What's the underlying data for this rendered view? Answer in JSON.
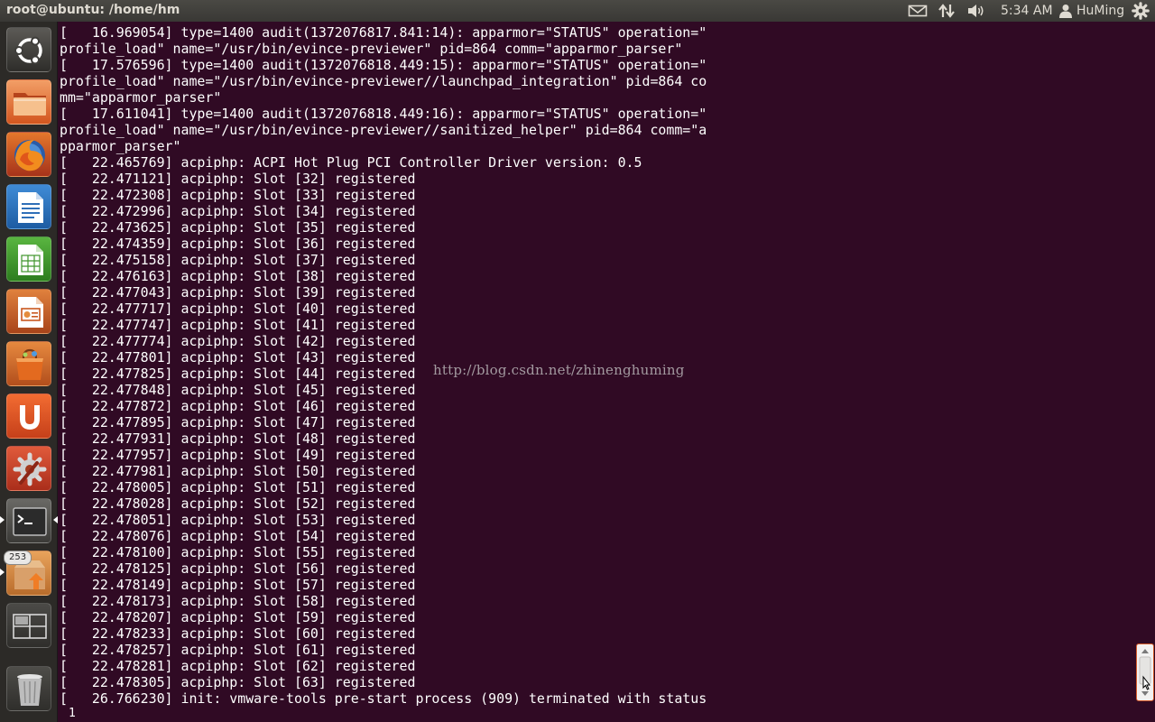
{
  "window": {
    "title": "root@ubuntu: /home/hm"
  },
  "panel": {
    "indicators": [
      "mail-icon",
      "network-icon",
      "volume-icon"
    ],
    "clock": "5:34 AM",
    "user": "HuMing"
  },
  "launcher": {
    "items": [
      {
        "name": "dash-home",
        "icon": "ubuntu-logo-icon"
      },
      {
        "name": "files",
        "icon": "folder-icon"
      },
      {
        "name": "firefox",
        "icon": "firefox-icon"
      },
      {
        "name": "writer",
        "icon": "libreoffice-writer-icon"
      },
      {
        "name": "calc",
        "icon": "libreoffice-calc-icon"
      },
      {
        "name": "impress",
        "icon": "libreoffice-impress-icon"
      },
      {
        "name": "software-center",
        "icon": "shopping-bag-icon"
      },
      {
        "name": "ubuntu-one",
        "icon": "ubuntu-one-icon"
      },
      {
        "name": "system-settings",
        "icon": "gear-wrench-icon"
      },
      {
        "name": "terminal",
        "icon": "terminal-icon"
      },
      {
        "name": "update-manager",
        "icon": "update-box-icon",
        "badge": "253"
      },
      {
        "name": "workspaces",
        "icon": "workspace-switcher-icon"
      },
      {
        "name": "trash",
        "icon": "trash-icon"
      }
    ],
    "colors": {
      "active_indicator": "#ffffff",
      "background": "#2c2a27"
    }
  },
  "terminal": {
    "colors": {
      "background": "#300a24",
      "foreground": "#ffffff"
    },
    "lines": [
      "[   16.969054] type=1400 audit(1372076817.841:14): apparmor=\"STATUS\" operation=\"",
      "profile_load\" name=\"/usr/bin/evince-previewer\" pid=864 comm=\"apparmor_parser\"",
      "[   17.576596] type=1400 audit(1372076818.449:15): apparmor=\"STATUS\" operation=\"",
      "profile_load\" name=\"/usr/bin/evince-previewer//launchpad_integration\" pid=864 co",
      "mm=\"apparmor_parser\"",
      "[   17.611041] type=1400 audit(1372076818.449:16): apparmor=\"STATUS\" operation=\"",
      "profile_load\" name=\"/usr/bin/evince-previewer//sanitized_helper\" pid=864 comm=\"a",
      "pparmor_parser\"",
      "[   22.465769] acpiphp: ACPI Hot Plug PCI Controller Driver version: 0.5",
      "[   22.471121] acpiphp: Slot [32] registered",
      "[   22.472308] acpiphp: Slot [33] registered",
      "[   22.472996] acpiphp: Slot [34] registered",
      "[   22.473625] acpiphp: Slot [35] registered",
      "[   22.474359] acpiphp: Slot [36] registered",
      "[   22.475158] acpiphp: Slot [37] registered",
      "[   22.476163] acpiphp: Slot [38] registered",
      "[   22.477043] acpiphp: Slot [39] registered",
      "[   22.477717] acpiphp: Slot [40] registered",
      "[   22.477747] acpiphp: Slot [41] registered",
      "[   22.477774] acpiphp: Slot [42] registered",
      "[   22.477801] acpiphp: Slot [43] registered",
      "[   22.477825] acpiphp: Slot [44] registered",
      "[   22.477848] acpiphp: Slot [45] registered",
      "[   22.477872] acpiphp: Slot [46] registered",
      "[   22.477895] acpiphp: Slot [47] registered",
      "[   22.477931] acpiphp: Slot [48] registered",
      "[   22.477957] acpiphp: Slot [49] registered",
      "[   22.477981] acpiphp: Slot [50] registered",
      "[   22.478005] acpiphp: Slot [51] registered",
      "[   22.478028] acpiphp: Slot [52] registered",
      "[   22.478051] acpiphp: Slot [53] registered",
      "[   22.478076] acpiphp: Slot [54] registered",
      "[   22.478100] acpiphp: Slot [55] registered",
      "[   22.478125] acpiphp: Slot [56] registered",
      "[   22.478149] acpiphp: Slot [57] registered",
      "[   22.478173] acpiphp: Slot [58] registered",
      "[   22.478207] acpiphp: Slot [59] registered",
      "[   22.478233] acpiphp: Slot [60] registered",
      "[   22.478257] acpiphp: Slot [61] registered",
      "[   22.478281] acpiphp: Slot [62] registered",
      "[   22.478305] acpiphp: Slot [63] registered",
      "[   26.766230] init: vmware-tools pre-start process (909) terminated with status"
    ],
    "last_line": "1",
    "watermark": "http://blog.csdn.net/zhinenghuming"
  }
}
